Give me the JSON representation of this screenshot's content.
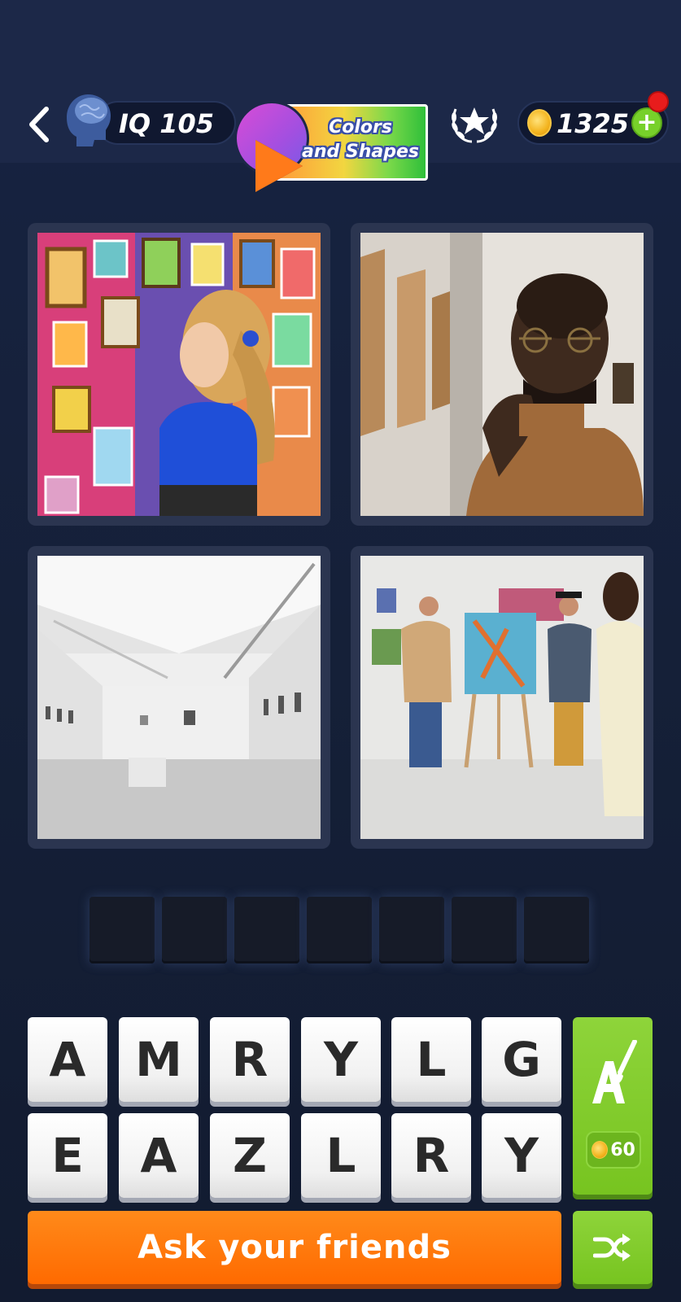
{
  "header": {
    "back_icon": "chevron-left-icon",
    "iq_label": "IQ 105",
    "pack_title": "Colors and Shapes",
    "laurel_icon": "star-laurel-icon",
    "coins": "1325",
    "add_coins_icon": "plus-icon"
  },
  "pictures": [
    {
      "subject": "girl-looking-at-colorful-paintings"
    },
    {
      "subject": "man-with-glasses-thinking-in-gallery"
    },
    {
      "subject": "empty-white-gallery-hall"
    },
    {
      "subject": "people-discussing-painting-on-easel"
    }
  ],
  "answer_length": 7,
  "keyboard": {
    "row1": [
      "A",
      "M",
      "R",
      "Y",
      "L",
      "G"
    ],
    "row2": [
      "E",
      "A",
      "Z",
      "L",
      "R",
      "Y"
    ]
  },
  "hint": {
    "icon": "paint-brush-letter-icon",
    "cost": "60"
  },
  "ask_friends_label": "Ask your friends",
  "shuffle_icon": "shuffle-icon",
  "colors": {
    "accent_orange": "#ff6a00",
    "accent_green": "#77c420",
    "background": "#152038"
  }
}
